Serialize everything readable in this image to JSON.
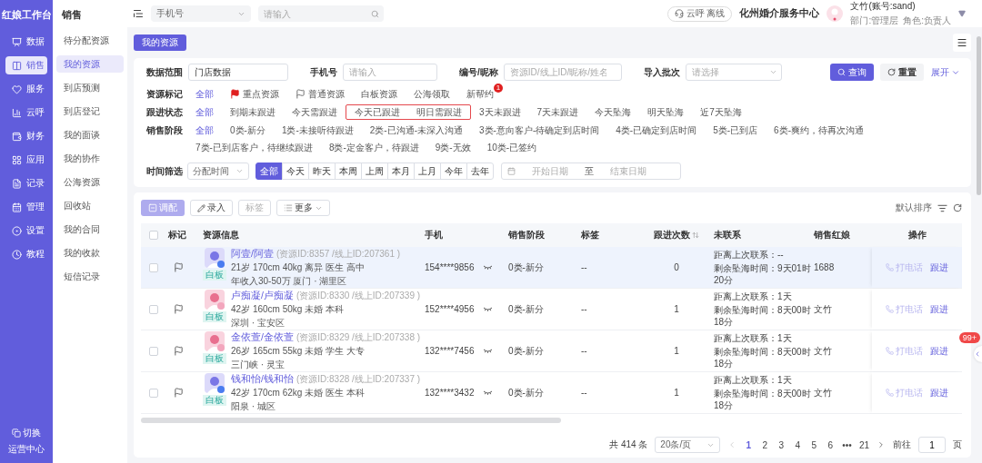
{
  "app_title": "红娘工作台",
  "rail": [
    {
      "label": "数据",
      "selected": false
    },
    {
      "label": "销售",
      "selected": true
    },
    {
      "label": "服务",
      "selected": false
    },
    {
      "label": "云呼",
      "selected": false
    },
    {
      "label": "财务",
      "selected": false
    },
    {
      "label": "应用",
      "selected": false
    },
    {
      "label": "记录",
      "selected": false
    },
    {
      "label": "管理",
      "selected": false
    },
    {
      "label": "设置",
      "selected": false
    },
    {
      "label": "教程",
      "selected": false
    }
  ],
  "rail_footer": {
    "switch": "切换",
    "center": "运营中心"
  },
  "section_title": "销售",
  "subnav": [
    {
      "label": "待分配资源",
      "selected": false
    },
    {
      "label": "我的资源",
      "selected": true
    },
    {
      "label": "到店预测",
      "selected": false
    },
    {
      "label": "到店登记",
      "selected": false
    },
    {
      "label": "我的面谈",
      "selected": false
    },
    {
      "label": "我的协作",
      "selected": false
    },
    {
      "label": "公海资源",
      "selected": false
    },
    {
      "label": "回收站",
      "selected": false
    },
    {
      "label": "我的合同",
      "selected": false
    },
    {
      "label": "我的收款",
      "selected": false
    },
    {
      "label": "短信记录",
      "selected": false
    }
  ],
  "topbar": {
    "search_type": "手机号",
    "search_placeholder": "请输入",
    "call_status": "云呼 离线",
    "org": "化州婚介服务中心",
    "user_name": "文竹(账号:sand)",
    "dept": "部门:管理层",
    "role": "角色:负责人"
  },
  "page_tabs": [
    {
      "label": "我的资源",
      "selected": true
    }
  ],
  "filters": {
    "fields": [
      {
        "label": "数据范围",
        "kind": "input",
        "value": "门店数据"
      },
      {
        "label": "手机号",
        "kind": "input",
        "placeholder": "请输入"
      },
      {
        "label": "编号/昵称",
        "kind": "input",
        "placeholder": "资源ID/线上ID/昵称/姓名"
      },
      {
        "label": "导入批次",
        "kind": "select",
        "placeholder": "请选择"
      }
    ],
    "query": "查询",
    "reset": "重置",
    "expand": "展开",
    "option_rows": [
      {
        "label": "资源标记",
        "options": [
          {
            "text": "全部",
            "selected": true,
            "kind": "plain",
            "outlined": false
          },
          {
            "text": "重点资源",
            "selected": false,
            "kind": "important",
            "outlined": false
          },
          {
            "text": "普通资源",
            "selected": false,
            "kind": "normal",
            "outlined": false
          },
          {
            "text": "白板资源",
            "selected": false,
            "kind": "plain",
            "outlined": false
          },
          {
            "text": "公海领取",
            "selected": false,
            "kind": "plain",
            "outlined": false
          },
          {
            "text": "新帮约",
            "selected": false,
            "kind": "plain",
            "outlined": false,
            "badge": "1"
          }
        ]
      },
      {
        "label": "跟进状态",
        "options": [
          {
            "text": "全部",
            "selected": true,
            "kind": "plain",
            "outlined": false
          },
          {
            "text": "到期未跟进",
            "selected": false,
            "kind": "plain",
            "outlined": false
          },
          {
            "text": "今天需跟进",
            "selected": false,
            "kind": "plain",
            "outlined": false
          },
          {
            "text": "今天已跟进",
            "selected": false,
            "kind": "plain",
            "outlined": true
          },
          {
            "text": "明日需跟进",
            "selected": false,
            "kind": "plain",
            "outlined": true
          },
          {
            "text": "3天未跟进",
            "selected": false,
            "kind": "plain",
            "outlined": false
          },
          {
            "text": "7天未跟进",
            "selected": false,
            "kind": "plain",
            "outlined": false
          },
          {
            "text": "今天坠海",
            "selected": false,
            "kind": "plain",
            "outlined": false
          },
          {
            "text": "明天坠海",
            "selected": false,
            "kind": "plain",
            "outlined": false
          },
          {
            "text": "近7天坠海",
            "selected": false,
            "kind": "plain",
            "outlined": false
          }
        ]
      },
      {
        "label": "销售阶段",
        "options": [
          {
            "text": "全部",
            "selected": true,
            "kind": "plain",
            "outlined": false
          },
          {
            "text": "0类-新分",
            "selected": false,
            "kind": "plain",
            "outlined": false
          },
          {
            "text": "1类-未接听待跟进",
            "selected": false,
            "kind": "plain",
            "outlined": false
          },
          {
            "text": "2类-已沟通-未深入沟通",
            "selected": false,
            "kind": "plain",
            "outlined": false
          },
          {
            "text": "3类-意向客户-待确定到店时间",
            "selected": false,
            "kind": "plain",
            "outlined": false
          },
          {
            "text": "4类-已确定到店时间",
            "selected": false,
            "kind": "plain",
            "outlined": false
          },
          {
            "text": "5类-已到店",
            "selected": false,
            "kind": "plain",
            "outlined": false
          },
          {
            "text": "6类-爽约，待再次沟通",
            "selected": false,
            "kind": "plain",
            "outlined": false
          },
          {
            "text": "7类-已到店客户，待继续跟进",
            "selected": false,
            "kind": "plain",
            "outlined": false
          },
          {
            "text": "8类-定金客户，待跟进",
            "selected": false,
            "kind": "plain",
            "outlined": false
          },
          {
            "text": "9类-无效",
            "selected": false,
            "kind": "plain",
            "outlined": false
          },
          {
            "text": "10类-已签约",
            "selected": false,
            "kind": "plain",
            "outlined": false
          }
        ]
      }
    ],
    "time_filter": {
      "label": "时间筛选",
      "type": "分配时间",
      "ranges": [
        {
          "text": "全部",
          "selected": true
        },
        {
          "text": "今天",
          "selected": false
        },
        {
          "text": "昨天",
          "selected": false
        },
        {
          "text": "本周",
          "selected": false
        },
        {
          "text": "上周",
          "selected": false
        },
        {
          "text": "本月",
          "selected": false
        },
        {
          "text": "上月",
          "selected": false
        },
        {
          "text": "今年",
          "selected": false
        },
        {
          "text": "去年",
          "selected": false
        }
      ],
      "start_placeholder": "开始日期",
      "separator": "至",
      "end_placeholder": "结束日期"
    }
  },
  "toolbar": {
    "buttons": [
      {
        "label": "调配",
        "kind": "primary",
        "disabled": true
      },
      {
        "label": "录入",
        "kind": "edit",
        "disabled": false
      },
      {
        "label": "标签",
        "kind": "plain",
        "disabled": true
      },
      {
        "label": "更多",
        "kind": "menu",
        "disabled": false
      }
    ],
    "sort": "默认排序"
  },
  "table": {
    "header_checked": false,
    "columns": [
      {
        "label": "标记"
      },
      {
        "label": "资源信息"
      },
      {
        "label": "手机"
      },
      {
        "label": "销售阶段"
      },
      {
        "label": "标签"
      },
      {
        "label": "跟进次数",
        "sortable": true
      },
      {
        "label": "未联系"
      },
      {
        "label": "销售红娘"
      },
      {
        "label": "操作"
      }
    ],
    "rows": [
      {
        "selected": true,
        "checked": false,
        "kind": "male",
        "name": "阿壹/阿壹",
        "ids": "(资源ID:8357 /线上ID:207361 )",
        "details": "21岁  170cm  40kg  离异  医生  高中",
        "extra": "年收入30-50万  厦门 · 湖里区",
        "tag": "白板",
        "phone": "154****9856",
        "stage": "0类-新分",
        "label": "--",
        "follow_count": "0",
        "last_contact": "距离上次联系：--",
        "remaining": "剩余坠海时间：9天01时20分",
        "matchmaker": "1688",
        "actions": [
          "打电话",
          "跟进"
        ]
      },
      {
        "selected": false,
        "checked": false,
        "kind": "female",
        "name": "卢痴凝/卢痴凝",
        "ids": "(资源ID:8330 /线上ID:207339 )",
        "details": "42岁  160cm  50kg  未婚  本科",
        "extra": "深圳 · 宝安区",
        "tag": "白板",
        "phone": "152****4956",
        "stage": "0类-新分",
        "label": "--",
        "follow_count": "1",
        "last_contact": "距离上次联系：1天",
        "remaining": "剩余坠海时间：8天00时18分",
        "matchmaker": "文竹",
        "actions": [
          "打电话",
          "跟进"
        ]
      },
      {
        "selected": false,
        "checked": false,
        "kind": "female",
        "name": "金依萱/金依萱",
        "ids": "(资源ID:8329 /线上ID:207338 )",
        "details": "26岁  165cm  55kg  未婚  学生  大专",
        "extra": "三门峡 · 灵宝",
        "tag": "白板",
        "phone": "132****7456",
        "stage": "0类-新分",
        "label": "--",
        "follow_count": "1",
        "last_contact": "距离上次联系：1天",
        "remaining": "剩余坠海时间：8天00时18分",
        "matchmaker": "文竹",
        "actions": [
          "打电话",
          "跟进"
        ]
      },
      {
        "selected": false,
        "checked": false,
        "kind": "male",
        "name": "钱和怡/钱和怡",
        "ids": "(资源ID:8328 /线上ID:207337 )",
        "details": "42岁  170cm  62kg  未婚  医生  本科",
        "extra": "阳泉 · 城区",
        "tag": "白板",
        "phone": "132****3432",
        "stage": "0类-新分",
        "label": "--",
        "follow_count": "1",
        "last_contact": "距离上次联系：1天",
        "remaining": "剩余坠海时间：8天00时18分",
        "matchmaker": "文竹",
        "actions": [
          "打电话",
          "跟进"
        ]
      }
    ]
  },
  "pagination": {
    "total": "共 414 条",
    "page_size": "20条/页",
    "pages": [
      {
        "text": "1",
        "selected": true
      },
      {
        "text": "2",
        "selected": false
      },
      {
        "text": "3",
        "selected": false
      },
      {
        "text": "4",
        "selected": false
      },
      {
        "text": "5",
        "selected": false
      },
      {
        "text": "6",
        "selected": false
      },
      {
        "text": "•••",
        "selected": false
      },
      {
        "text": "21",
        "selected": false
      }
    ],
    "goto": "前往",
    "page_input": "1",
    "page_unit": "页"
  },
  "floating_badge": "99+"
}
